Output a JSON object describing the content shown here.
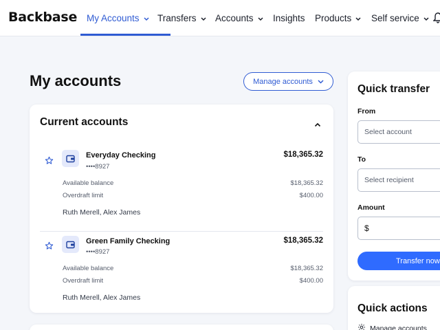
{
  "brand": {
    "logo": "Backbase"
  },
  "nav": {
    "items": [
      {
        "label": "My Accounts",
        "has_dropdown": true,
        "active": true
      },
      {
        "label": "Transfers",
        "has_dropdown": true
      },
      {
        "label": "Accounts",
        "has_dropdown": true
      },
      {
        "label": "Insights",
        "has_dropdown": false
      },
      {
        "label": "Products",
        "has_dropdown": true
      },
      {
        "label": "Self service",
        "has_dropdown": true
      }
    ],
    "notification_icon": "bell-icon"
  },
  "page": {
    "title": "My accounts",
    "manage_button": "Manage accounts"
  },
  "current_accounts": {
    "title": "Current accounts",
    "accounts": [
      {
        "name": "Everyday Checking",
        "number": "••••8927",
        "balance": "$18,365.32",
        "available_label": "Available balance",
        "available_value": "$18,365.32",
        "overdraft_label": "Overdraft limit",
        "overdraft_value": "$400.00",
        "holders": "Ruth Merell, Alex James"
      },
      {
        "name": "Green Family Checking",
        "number": "••••8927",
        "balance": "$18,365.32",
        "available_label": "Available balance",
        "available_value": "$18,365.32",
        "overdraft_label": "Overdraft limit",
        "overdraft_value": "$400.00",
        "holders": "Ruth Merell, Alex James"
      }
    ]
  },
  "quick_transfer": {
    "title": "Quick transfer",
    "from_label": "From",
    "from_placeholder": "Select account",
    "to_label": "To",
    "to_placeholder": "Select recipient",
    "amount_label": "Amount",
    "amount_prefix": "$",
    "button": "Transfer now"
  },
  "quick_actions": {
    "title": "Quick actions",
    "items": [
      {
        "label": "Manage accounts",
        "icon": "gear-icon"
      }
    ]
  },
  "colors": {
    "accent": "#2f5bd3",
    "primary_button": "#2f6bff",
    "background": "#f4f6fa"
  }
}
